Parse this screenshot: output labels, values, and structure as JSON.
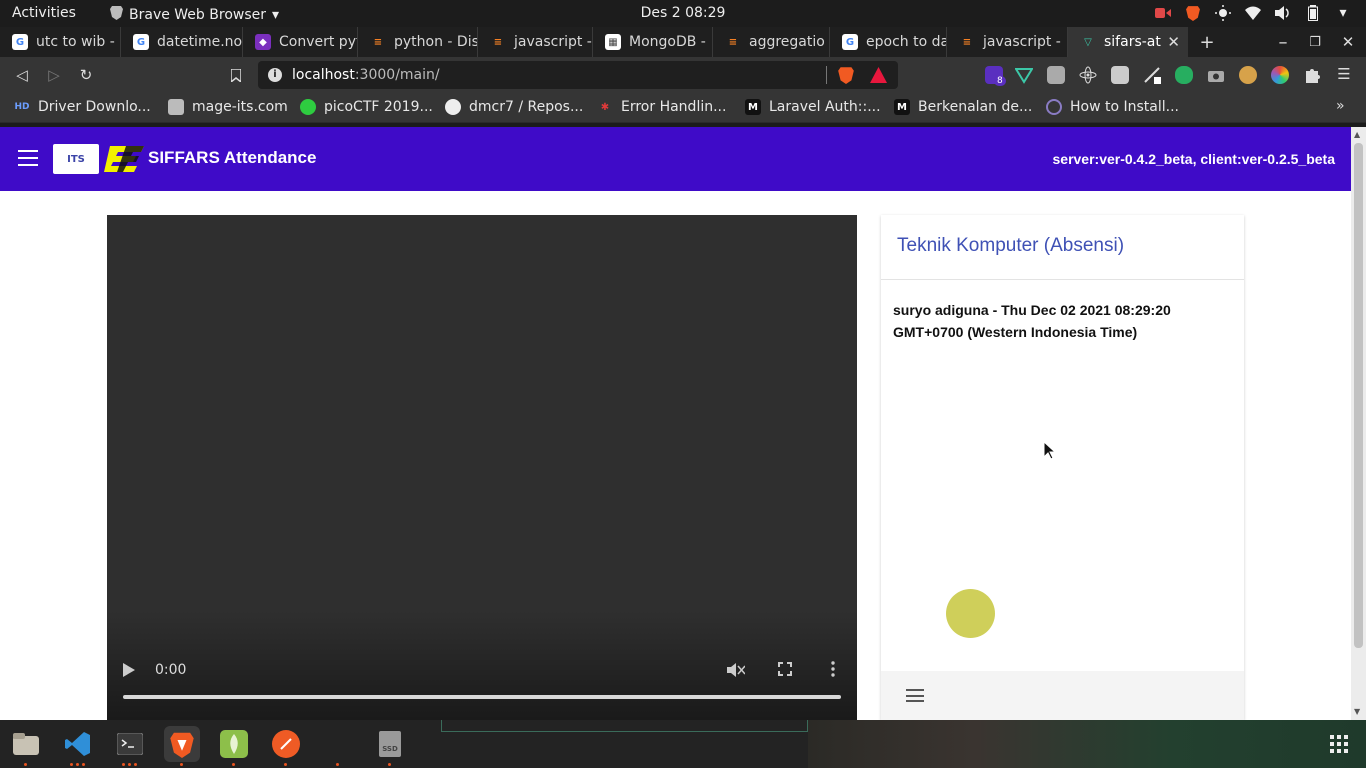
{
  "gnome": {
    "activities": "Activities",
    "app_name": "Brave Web Browser",
    "clock": "Des 2  08:29"
  },
  "tabs": [
    {
      "title": "utc to wib - "
    },
    {
      "title": "datetime.no"
    },
    {
      "title": "Convert pyt"
    },
    {
      "title": "python - Dis"
    },
    {
      "title": "javascript - "
    },
    {
      "title": "MongoDB - "
    },
    {
      "title": "aggregatio"
    },
    {
      "title": "epoch to da"
    },
    {
      "title": "javascript - "
    },
    {
      "title": "sifars-at",
      "active": true
    }
  ],
  "address_bar": {
    "host": "localhost",
    "path": ":3000/main/"
  },
  "extensions": {
    "badge_count": "8"
  },
  "bookmarks": [
    {
      "label": "Driver Downlo..."
    },
    {
      "label": "mage-its.com"
    },
    {
      "label": "picoCTF 2019..."
    },
    {
      "label": "dmcr7 / Repos..."
    },
    {
      "label": "Error Handlin..."
    },
    {
      "label": "Laravel Auth::..."
    },
    {
      "label": "Berkenalan de..."
    },
    {
      "label": "How to Install..."
    }
  ],
  "app": {
    "its_logo_text": "ITS",
    "title": "SIFFARS Attendance",
    "version": "server:ver-0.4.2_beta, client:ver-0.2.5_beta"
  },
  "video": {
    "time": "0:00",
    "progress": 0
  },
  "panel": {
    "title": "Teknik Komputer (Absensi)",
    "log": "suryo adiguna - Thu Dec 02 2021 08:29:20 GMT+0700 (Western Indonesia Time)",
    "dot_color": "#cfcf5a"
  },
  "dock": {
    "drive_label": "SSD"
  },
  "colors": {
    "appbar": "#3f0bc8",
    "panel_title": "#3f51b5",
    "ubuntu_accent": "#e95420"
  }
}
